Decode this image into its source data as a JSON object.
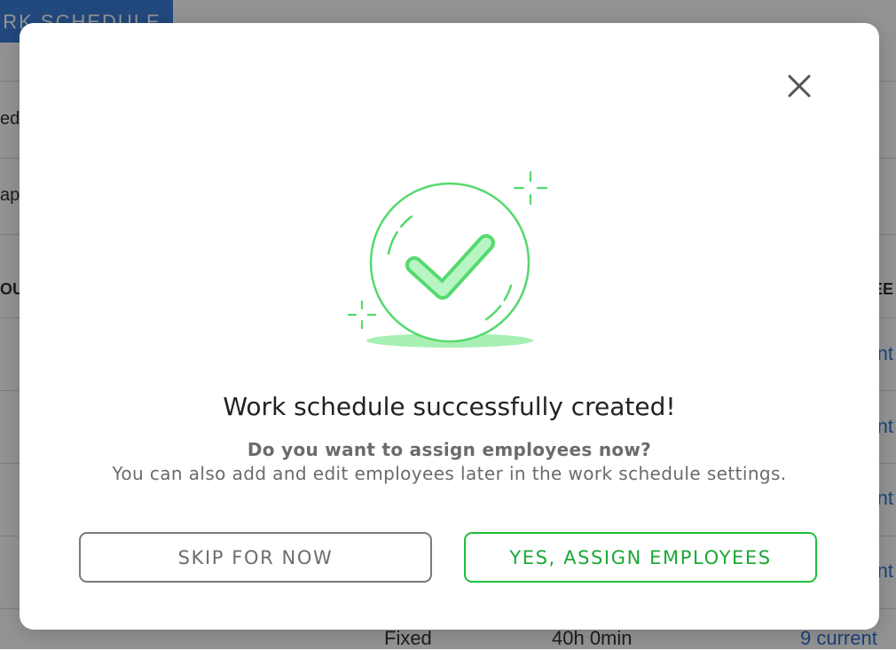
{
  "background": {
    "top_button_label": "RK SCHEDULE",
    "left_fragments": [
      "ed",
      "ap",
      "OU"
    ],
    "right_header_fragment": "EE",
    "row_link_fragments": [
      "nt",
      "nt",
      "nt",
      "nt"
    ],
    "last_row": {
      "type": "Fixed",
      "hours": "40h 0min",
      "employees": "9 current"
    }
  },
  "modal": {
    "close_icon": "close-icon",
    "illustration_icon": "success-checkmark-icon",
    "title": "Work schedule successfully created!",
    "question": "Do you want to assign employees now?",
    "hint": "You can also add and edit employees later in the work schedule settings.",
    "skip_label": "SKIP FOR NOW",
    "assign_label": "YES, ASSIGN EMPLOYEES"
  },
  "colors": {
    "accent_green": "#1fbf3a",
    "check_green": "#55d96e",
    "link_blue": "#2f74d0",
    "overlay": "rgba(0,0,0,0.42)"
  }
}
